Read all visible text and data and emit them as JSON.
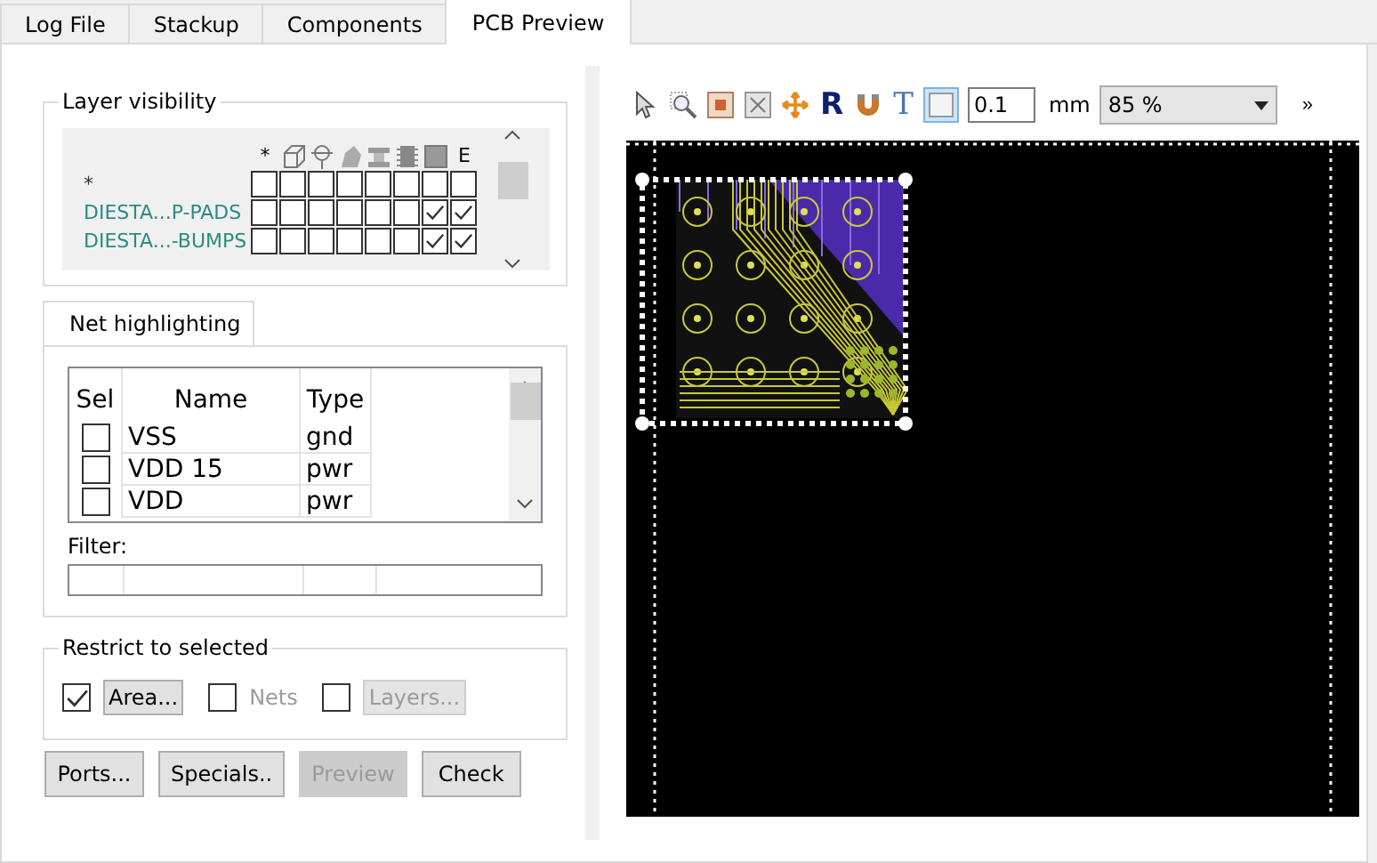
{
  "tabs": [
    {
      "label": "Log File",
      "selected": false
    },
    {
      "label": "Stackup",
      "selected": false
    },
    {
      "label": "Components",
      "selected": false
    },
    {
      "label": "PCB Preview",
      "selected": true
    }
  ],
  "layer_visibility": {
    "title": "Layer visibility",
    "columns": [
      {
        "kind": "text",
        "label": "*"
      },
      {
        "kind": "icon"
      },
      {
        "kind": "icon"
      },
      {
        "kind": "icon"
      },
      {
        "kind": "icon"
      },
      {
        "kind": "icon"
      },
      {
        "kind": "icon"
      },
      {
        "kind": "text",
        "label": "E"
      }
    ],
    "rows": [
      {
        "name": "*",
        "kind": "all",
        "checks": [
          false,
          false,
          false,
          false,
          false,
          false,
          false,
          false
        ]
      },
      {
        "name": "DIESTA...P-PADS",
        "kind": "layer",
        "checks": [
          false,
          false,
          false,
          false,
          false,
          false,
          true,
          true
        ]
      },
      {
        "name": "DIESTA...-BUMPS",
        "kind": "layer",
        "checks": [
          false,
          false,
          false,
          false,
          false,
          false,
          true,
          true
        ]
      }
    ]
  },
  "net_highlighting": {
    "tab": "Net highlighting",
    "columns": [
      "Sel",
      "Name",
      "Type"
    ],
    "rows": [
      {
        "name": "VSS",
        "type": "gnd",
        "checked": false
      },
      {
        "name": "VDD 15",
        "type": "pwr",
        "checked": false
      },
      {
        "name": "VDD",
        "type": "pwr",
        "checked": false
      }
    ],
    "filter_label": "Filter:"
  },
  "restrict": {
    "title": "Restrict to selected",
    "options": [
      {
        "kind": "button",
        "label": "Area...",
        "checked": true,
        "disabled": false
      },
      {
        "kind": "label",
        "label": "Nets",
        "checked": false,
        "disabled": true
      },
      {
        "kind": "button",
        "label": "Layers...",
        "checked": false,
        "disabled": true
      }
    ]
  },
  "buttons": [
    {
      "label": "Ports...",
      "disabled": false
    },
    {
      "label": "Specials..",
      "disabled": false
    },
    {
      "label": "Preview",
      "disabled": true
    },
    {
      "label": "Check",
      "disabled": false
    }
  ],
  "toolbar": {
    "tools": [
      {
        "kind": "icon"
      },
      {
        "kind": "icon"
      },
      {
        "kind": "icon"
      },
      {
        "kind": "icon"
      },
      {
        "kind": "icon"
      },
      {
        "kind": "glyph",
        "label": "R"
      },
      {
        "kind": "icon"
      },
      {
        "kind": "glyph",
        "label": "T"
      },
      {
        "kind": "toggle",
        "selected": true
      }
    ],
    "grid_value": "0.1",
    "unit": "mm",
    "zoom": "85 %",
    "more": "»"
  }
}
